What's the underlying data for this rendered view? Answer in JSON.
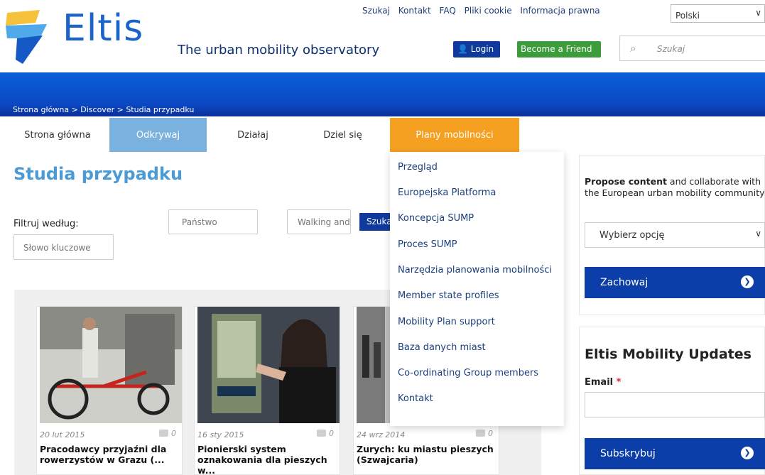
{
  "header": {
    "brand": "Eltis",
    "tagline": "The urban mobility observatory",
    "top_links": [
      "Szukaj",
      "Kontakt",
      "FAQ",
      "Pliki cookie",
      "Informacja prawna"
    ],
    "language": "Polski",
    "login_label": "Login",
    "friend_label": "Become a Friend",
    "search_placeholder": "Szukaj"
  },
  "breadcrumb": "Strona główna > Discover > Studia przypadku",
  "nav": [
    "Strona główna",
    "Odkrywaj",
    "Działaj",
    "Dziel się",
    "Plany mobilności"
  ],
  "main": {
    "title": "Studia przypadku",
    "filter_label": "Filtruj według:",
    "country_placeholder": "Państwo",
    "keyword_placeholder": "Słowo kluczowe",
    "walking_value": "Walking and",
    "search_button": "Szukaj"
  },
  "dropdown": [
    "Przegląd",
    "Europejska Platforma",
    "Koncepcja SUMP",
    "Proces SUMP",
    "Narzędzia planowania mobilności",
    "Member state profiles",
    "Mobility Plan support",
    "Baza danych miast",
    "Co-ordinating Group members",
    "Kontakt"
  ],
  "cards": [
    {
      "date": "20 lut 2015",
      "likes": "0",
      "title": "Pracodawcy przyjaźni dla rowerzystów w Grazu (..."
    },
    {
      "date": "16 sty 2015",
      "likes": "0",
      "title": "Pionierski system oznakowania dla pieszych w..."
    },
    {
      "date": "24 wrz 2014",
      "likes": "0",
      "title": "Zurych: ku miastu pieszych (Szwajcaria)"
    }
  ],
  "sidebar": {
    "propose_bold": "Propose content",
    "propose_rest": " and collaborate with the European urban mobility community",
    "select_value": "Wybierz opcję",
    "save_button": "Zachowaj",
    "updates_title": "Eltis Mobility Updates",
    "email_label": "Email",
    "required_mark": "*",
    "subscribe_button": "Subskrybuj"
  },
  "colors": {
    "brand_blue": "#1a63c9",
    "nav_active": "#7ab1df",
    "nav_highlight": "#f5a020",
    "button_blue": "#0b3ea8",
    "friend_green": "#3c9b3a"
  }
}
